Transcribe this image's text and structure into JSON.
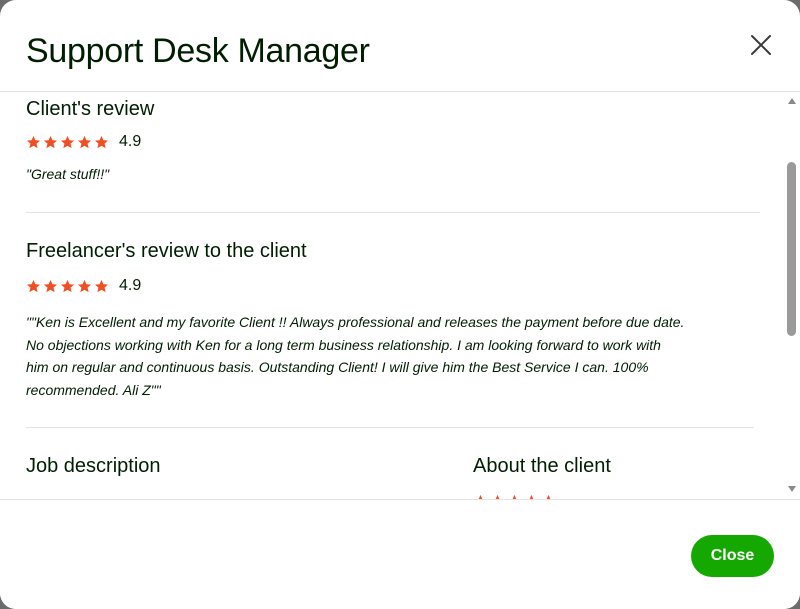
{
  "modal": {
    "title": "Support Desk Manager"
  },
  "client_review": {
    "heading": "Client's review",
    "rating": 4.9,
    "rating_text": "4.9",
    "stars_max": 5,
    "text": "\"Great stuff!!\""
  },
  "freelancer_review": {
    "heading": "Freelancer's review to the client",
    "rating": 4.9,
    "rating_text": "4.9",
    "stars_max": 5,
    "text_lines": [
      "\"\"Ken is Excellent and my favorite Client !! Always professional and releases the payment before due date.",
      "No objections working with Ken for a long term business relationship. I am looking forward to work with",
      "him on regular and continuous basis. Outstanding Client! I will give him the Best Service I can. 100%",
      "recommended. Ali Z\"\""
    ]
  },
  "job_description": {
    "heading": "Job description"
  },
  "about_client": {
    "heading": "About the client"
  },
  "footer": {
    "close_label": "Close"
  },
  "colors": {
    "star": "#f04e23",
    "primary_button": "#14a800",
    "text": "#001e00",
    "divider": "#e4e4e4"
  }
}
